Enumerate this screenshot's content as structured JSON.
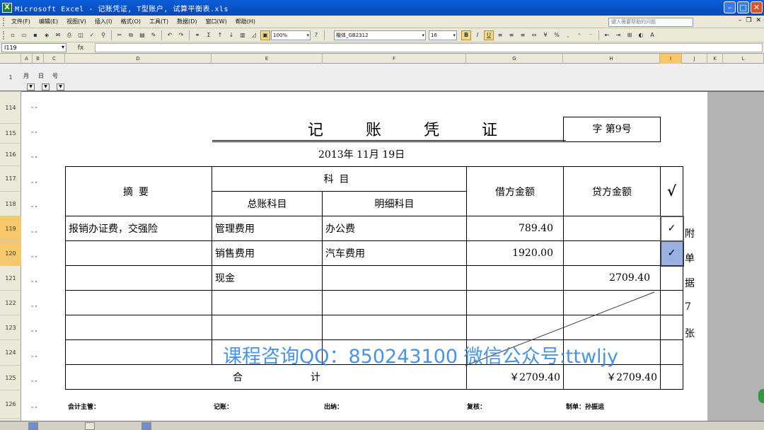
{
  "window": {
    "title": "Microsoft Excel - 记账凭证, T型账户, 试算平衡表.xls",
    "app_icon": "X"
  },
  "menu": {
    "items": [
      "文件(F)",
      "编辑(E)",
      "视图(V)",
      "插入(I)",
      "格式(O)",
      "工具(T)",
      "数据(D)",
      "窗口(W)",
      "帮助(H)"
    ],
    "help_placeholder": "键入需要帮助的问题"
  },
  "toolbar": {
    "zoom": "100%",
    "font": "楷体_GB2312",
    "size": "16",
    "bold": "B",
    "italic": "I",
    "underline": "U"
  },
  "formula_bar": {
    "name_box": "I119",
    "fx": "fx"
  },
  "columns": [
    "A",
    "B",
    "C",
    "D",
    "E",
    "F",
    "G",
    "H",
    "I",
    "J",
    "K",
    "L"
  ],
  "selected_column": "I",
  "filter_labels": [
    "月",
    "日",
    "号"
  ],
  "rows": [
    "1",
    "114",
    "115",
    "116",
    "117",
    "118",
    "119",
    "120",
    "121",
    "122",
    "123",
    "124",
    "125",
    "126"
  ],
  "voucher": {
    "title": "记账凭证",
    "number": "字 第9号",
    "date": "2013年 11月 19日",
    "headers": {
      "summary": "摘要",
      "account": "科目",
      "general": "总账科目",
      "detail": "明细科目",
      "debit": "借方金额",
      "credit": "贷方金额",
      "check": "√"
    },
    "entries": [
      {
        "summary": "报销办证费，交强险",
        "general": "管理费用",
        "detail": "办公费",
        "debit": "789.40",
        "credit": "",
        "check": "✓"
      },
      {
        "summary": "",
        "general": "销售费用",
        "detail": "汽车费用",
        "debit": "1920.00",
        "credit": "",
        "check": "✓"
      },
      {
        "summary": "",
        "general": "现金",
        "detail": "",
        "debit": "",
        "credit": "2709.40",
        "check": ""
      }
    ],
    "total_label_1": "合",
    "total_label_2": "计",
    "total_debit": "￥2709.40",
    "total_credit": "￥2709.40",
    "attachments": [
      "附",
      "单",
      "据",
      "7",
      "张"
    ],
    "footer": {
      "supervisor": "会计主管：",
      "bookkeeper": "记账：",
      "cashier": "出纳：",
      "reviewer": "复核：",
      "maker": "制单：孙振运"
    }
  },
  "watermark": "课程咨询QQ：850243100  微信公众号:ttwljy"
}
